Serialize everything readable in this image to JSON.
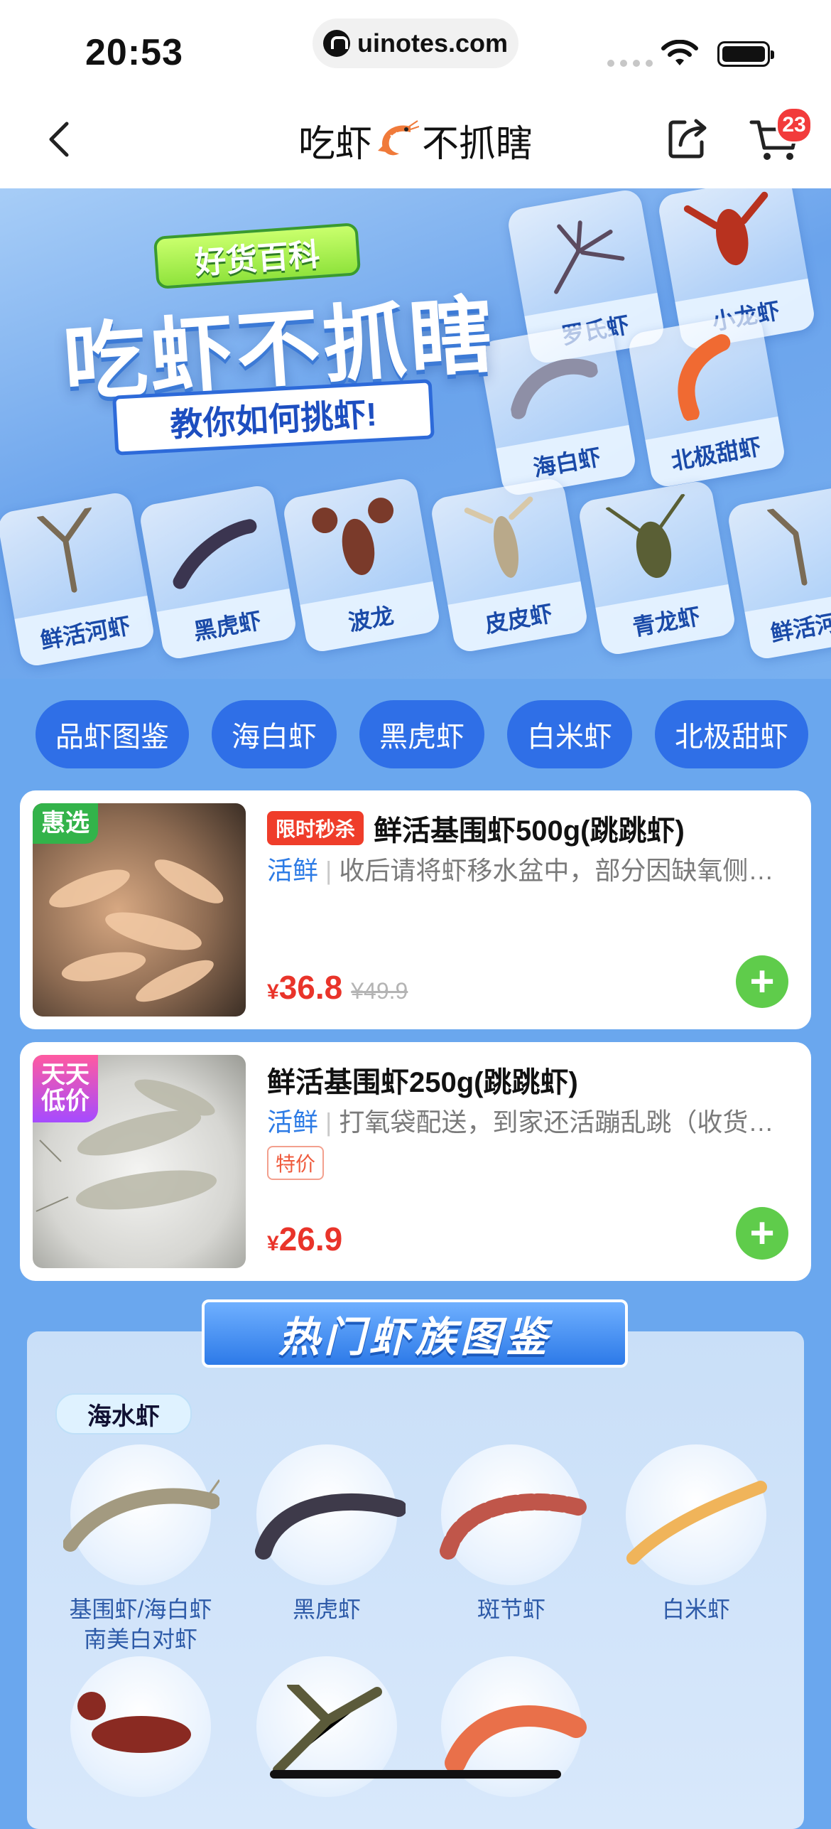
{
  "status_bar": {
    "time": "20:53",
    "url": "uinotes.com"
  },
  "nav": {
    "title_left": "吃虾",
    "title_right": "不抓瞎",
    "cart_count": "23"
  },
  "banner": {
    "tag": "好货百科",
    "title": "吃虾不抓瞎",
    "subtitle": "教你如何挑虾!",
    "tiles": [
      "罗氏虾",
      "小龙虾",
      "海白虾",
      "北极甜虾",
      "鲜活河虾",
      "黑虎虾",
      "波龙",
      "皮皮虾",
      "青龙虾",
      "鲜活河虾"
    ]
  },
  "chips": [
    "品虾图鉴",
    "海白虾",
    "黑虎虾",
    "白米虾",
    "北极甜虾"
  ],
  "products": [
    {
      "badge": "惠选",
      "flash": "限时秒杀",
      "name": "鲜活基围虾500g(跳跳虾)",
      "tag": "活鲜",
      "desc": "收后请将虾移水盆中，部分因缺氧侧…",
      "currency": "¥",
      "price": "36.8",
      "old_price": "¥49.9"
    },
    {
      "badge": "天天低价",
      "badge_line1": "天天",
      "badge_line2": "低价",
      "name": "鲜活基围虾250g(跳跳虾)",
      "tag": "活鲜",
      "desc": "打氧袋配送，到家还活蹦乱跳（收货…",
      "special": "特价",
      "currency": "¥",
      "price": "26.9"
    }
  ],
  "encyclopedia": {
    "title": "热门虾族图鉴",
    "category": "海水虾",
    "species": [
      {
        "name_line1": "基围虾/海白虾",
        "name_line2": "南美白对虾"
      },
      {
        "name_line1": "黑虎虾",
        "name_line2": ""
      },
      {
        "name_line1": "斑节虾",
        "name_line2": ""
      },
      {
        "name_line1": "白米虾",
        "name_line2": ""
      }
    ]
  },
  "colors": {
    "primary_blue": "#2f6fe7",
    "price_red": "#e9342a",
    "add_green": "#5fcc4b",
    "tag_blue": "#2d7be5"
  }
}
